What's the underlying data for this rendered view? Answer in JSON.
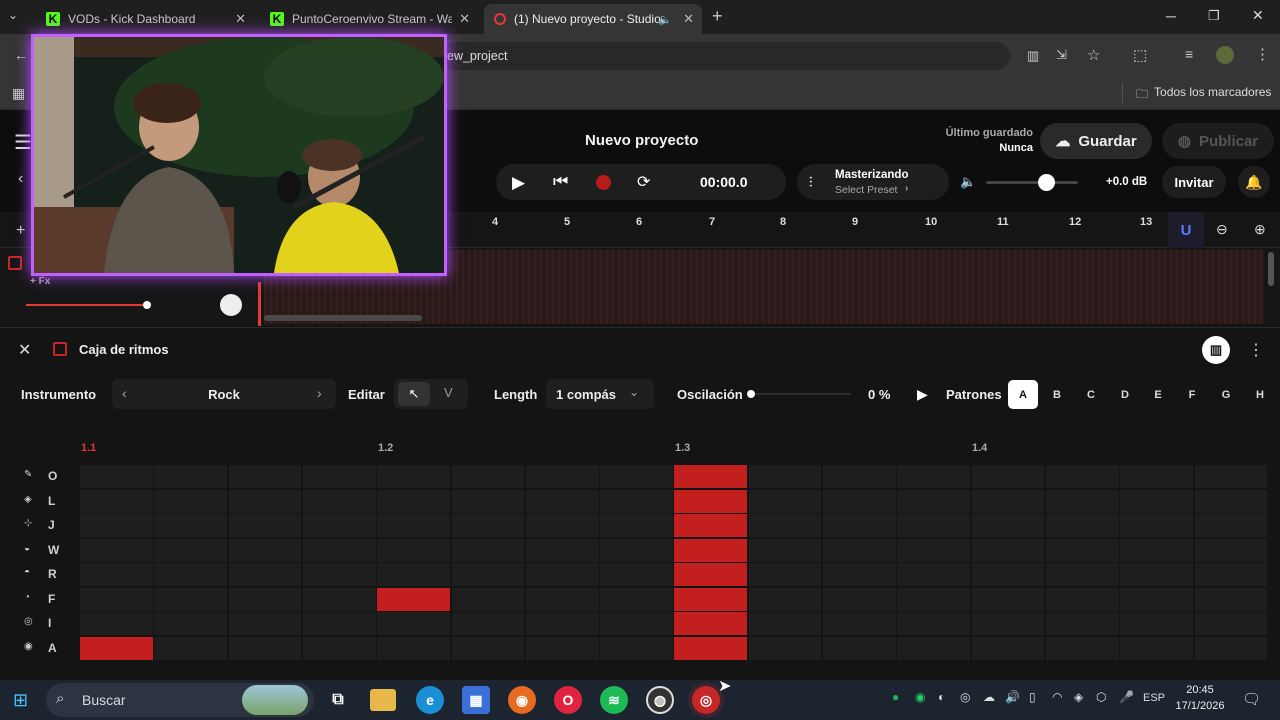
{
  "browser": {
    "tabs": [
      {
        "title": "VODs - Kick Dashboard",
        "favicon": "kick-icon"
      },
      {
        "title": "PuntoCeroenvivo Stream - Wat",
        "favicon": "kick-icon"
      },
      {
        "title": "(1) Nuevo proyecto - Studio",
        "favicon": "studio-icon",
        "active": true
      }
    ],
    "new_tab": "+",
    "url_partial": "ew_project",
    "bookmarks_folder": "Todos los marcadores"
  },
  "app": {
    "project_title": "Nuevo proyecto",
    "last_saved_label": "Último guardado",
    "last_saved_value": "Nunca",
    "save_label": "Guardar",
    "publish_label": "Publicar",
    "time": "00:00.0",
    "mastering_title": "Masterizando",
    "mastering_preset": "Select Preset",
    "volume_db": "+0.0 dB",
    "invite_label": "Invitar",
    "fx_label": "+ Fx",
    "ruler_numbers": [
      "4",
      "5",
      "6",
      "7",
      "8",
      "9",
      "10",
      "11",
      "12",
      "13"
    ]
  },
  "beatbox": {
    "title": "Caja de ritmos",
    "instrument_label": "Instrumento",
    "instrument_value": "Rock",
    "edit_label": "Editar",
    "length_label": "Length",
    "length_value": "1 compás",
    "swing_label": "Oscilación",
    "swing_value": "0 %",
    "patterns_label": "Patrones",
    "patterns": [
      "A",
      "B",
      "C",
      "D",
      "E",
      "F",
      "G",
      "H"
    ],
    "selected_pattern": "A",
    "beats": [
      "1.1",
      "1.2",
      "1.3",
      "1.4"
    ],
    "rows": [
      {
        "key": "O",
        "steps": [
          0,
          0,
          0,
          0,
          0,
          0,
          0,
          0,
          1,
          0,
          0,
          0,
          0,
          0,
          0,
          0
        ]
      },
      {
        "key": "L",
        "steps": [
          0,
          0,
          0,
          0,
          0,
          0,
          0,
          0,
          1,
          0,
          0,
          0,
          0,
          0,
          0,
          0
        ]
      },
      {
        "key": "J",
        "steps": [
          0,
          0,
          0,
          0,
          0,
          0,
          0,
          0,
          1,
          0,
          0,
          0,
          0,
          0,
          0,
          0
        ]
      },
      {
        "key": "W",
        "steps": [
          0,
          0,
          0,
          0,
          0,
          0,
          0,
          0,
          1,
          0,
          0,
          0,
          0,
          0,
          0,
          0
        ]
      },
      {
        "key": "R",
        "steps": [
          0,
          0,
          0,
          0,
          0,
          0,
          0,
          0,
          1,
          0,
          0,
          0,
          0,
          0,
          0,
          0
        ]
      },
      {
        "key": "F",
        "steps": [
          0,
          0,
          0,
          0,
          1,
          0,
          0,
          0,
          1,
          0,
          0,
          0,
          0,
          0,
          0,
          0
        ]
      },
      {
        "key": "I",
        "steps": [
          0,
          0,
          0,
          0,
          0,
          0,
          0,
          0,
          1,
          0,
          0,
          0,
          0,
          0,
          0,
          0
        ]
      },
      {
        "key": "A",
        "steps": [
          1,
          0,
          0,
          0,
          0,
          0,
          0,
          0,
          1,
          0,
          0,
          0,
          0,
          0,
          0,
          0
        ]
      }
    ],
    "accent_color": "#c41f1f"
  },
  "taskbar": {
    "search_placeholder": "Buscar",
    "lang": "ESP",
    "time": "20:45",
    "date": "17/1/2026"
  }
}
